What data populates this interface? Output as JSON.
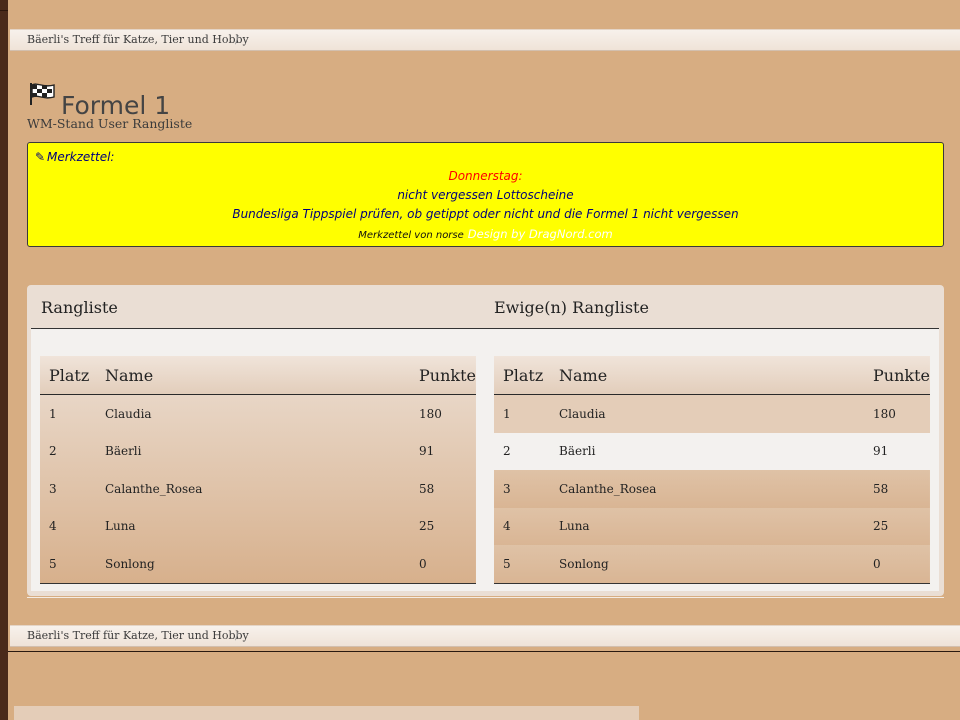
{
  "breadcrumb": {
    "home": "Bäerli's Treff für Katze, Tier und Hobby",
    "separator": "/"
  },
  "header": {
    "title": "Formel 1",
    "subtitle": "WM-Stand User Rangliste"
  },
  "note": {
    "heading": "Merkzettel:",
    "line1": "Donnerstag:",
    "line2": "nicht vergessen Lottoscheine",
    "line3": "Bundesliga Tippspiel prüfen, ob getippt oder nicht und die Formel 1 nicht vergessen",
    "credit": "Merkzettel von norse",
    "design": "Design by DragNord.com",
    "colors": {
      "background": "#ffff00",
      "highlight": "#ff0000",
      "text": "#00007a"
    }
  },
  "rankings": {
    "left_title": "Rangliste",
    "right_title": "Ewige(n) Rangliste",
    "columns": {
      "platz": "Platz",
      "name": "Name",
      "punkte": "Punkte"
    },
    "left_rows": [
      {
        "platz": "1",
        "name": "Claudia",
        "punkte": "180"
      },
      {
        "platz": "2",
        "name": "Bäerli",
        "punkte": "91"
      },
      {
        "platz": "3",
        "name": "Calanthe_Rosea",
        "punkte": "58"
      },
      {
        "platz": "4",
        "name": "Luna",
        "punkte": "25"
      },
      {
        "platz": "5",
        "name": "Sonlong",
        "punkte": "0"
      }
    ],
    "right_rows": [
      {
        "platz": "1",
        "name": "Claudia",
        "punkte": "180"
      },
      {
        "platz": "2",
        "name": "Bäerli",
        "punkte": "91"
      },
      {
        "platz": "3",
        "name": "Calanthe_Rosea",
        "punkte": "58"
      },
      {
        "platz": "4",
        "name": "Luna",
        "punkte": "25"
      },
      {
        "platz": "5",
        "name": "Sonlong",
        "punkte": "0"
      }
    ]
  },
  "icons": {
    "title": "checkered-flag-icon",
    "note": "pencil-icon"
  }
}
